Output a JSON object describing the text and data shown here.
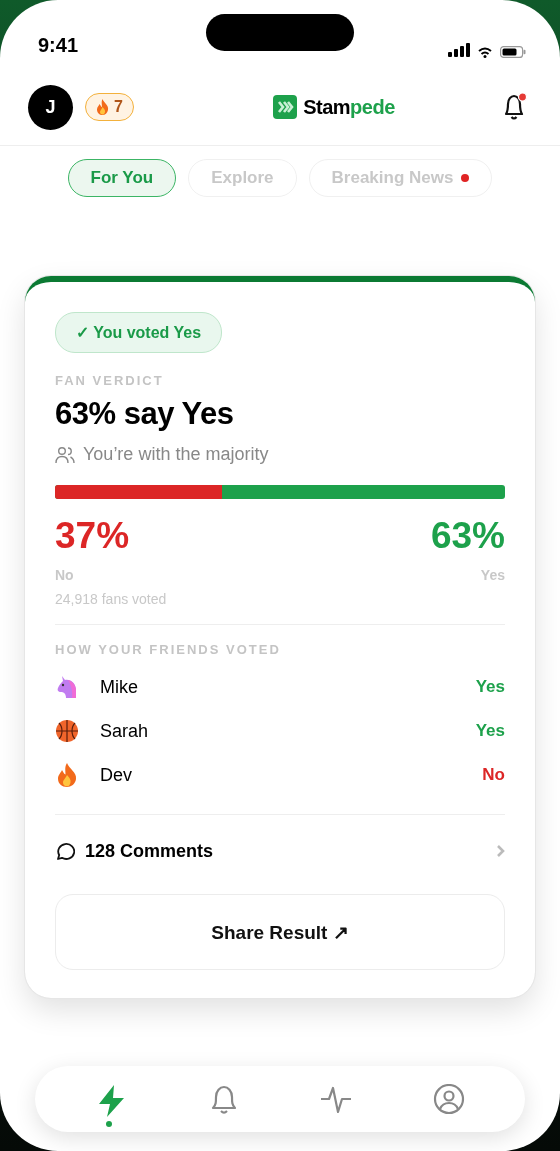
{
  "status_bar": {
    "time": "9:41"
  },
  "header": {
    "avatar": "J",
    "streak": "7",
    "logo": {
      "dark": "Stam",
      "accent": "pede"
    },
    "bell_has_notification": true
  },
  "tabs": [
    {
      "label": "For You",
      "selected": true,
      "live": false
    },
    {
      "label": "Explore",
      "selected": false,
      "live": false
    },
    {
      "label": "Breaking News",
      "selected": false,
      "live": true
    }
  ],
  "card": {
    "vote_badge": {
      "check": "✓",
      "text": "You voted Yes"
    },
    "label": "FAN VERDICT",
    "headline": "63% say Yes",
    "majority": "You’re with the majority",
    "bar": {
      "level": 0.37
    },
    "results": [
      {
        "kind": "no",
        "percent": "37%",
        "label": "No"
      },
      {
        "kind": "yes",
        "percent": "63%",
        "label": "Yes"
      }
    ],
    "total": "24,918 fans voted",
    "friends_heading": "HOW YOUR FRIENDS VOTED",
    "friends": [
      {
        "kind": "unicorn",
        "name": "Mike",
        "vote": "Yes",
        "voted_yes": true
      },
      {
        "kind": "basketball",
        "name": "Sarah",
        "vote": "Yes",
        "voted_yes": true
      },
      {
        "kind": "fire",
        "name": "Dev",
        "vote": "No",
        "voted_yes": false
      }
    ],
    "comments": "128 Comments",
    "share": "Share Result ↗"
  },
  "nav": [
    {
      "kind": "bolt",
      "selected": true
    },
    {
      "kind": "bell",
      "selected": false
    },
    {
      "kind": "activity",
      "selected": false
    },
    {
      "kind": "profile",
      "selected": false
    }
  ]
}
